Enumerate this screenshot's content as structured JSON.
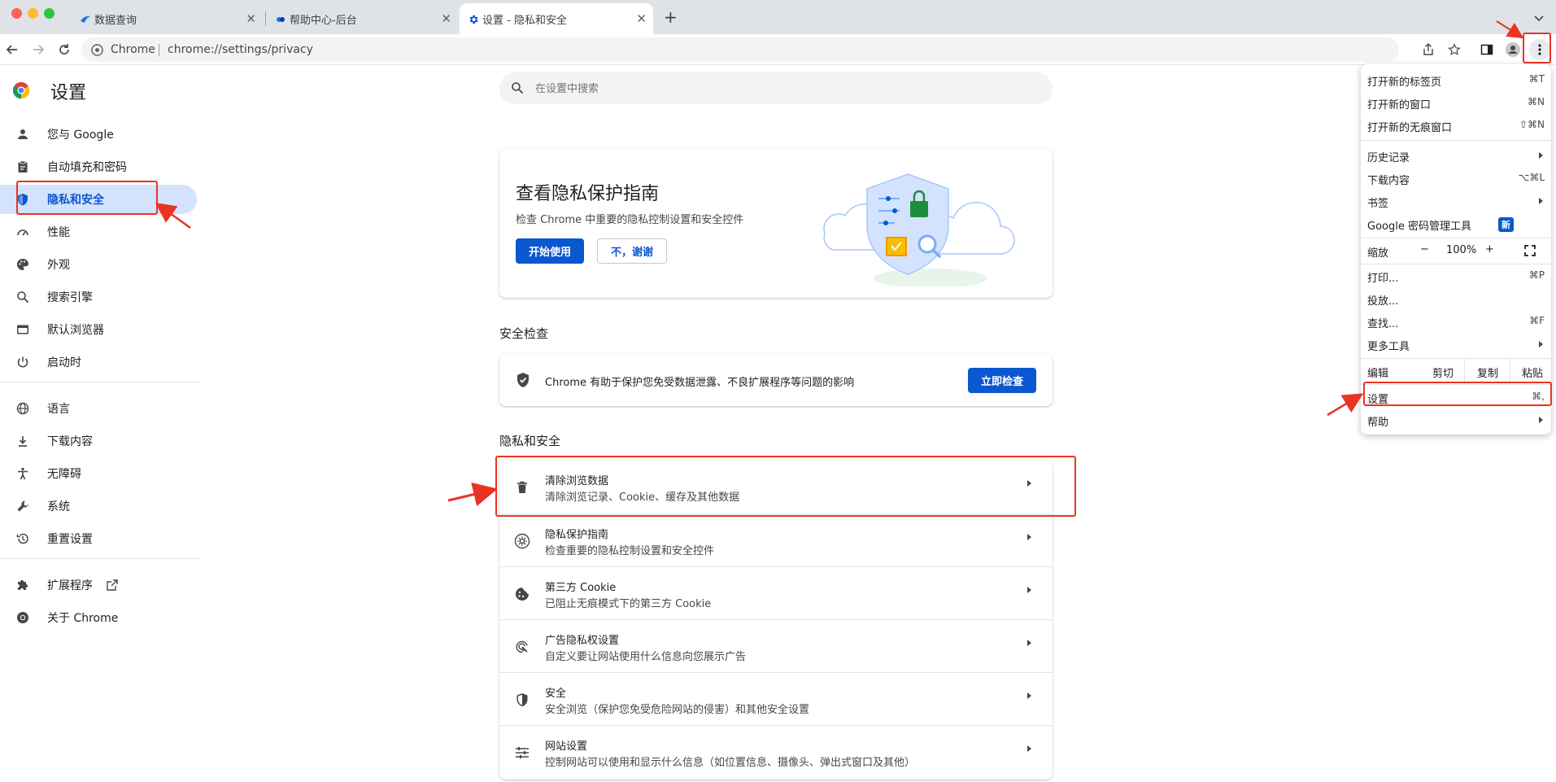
{
  "tabs": [
    {
      "title": "数据查询"
    },
    {
      "title": "帮助中心-后台"
    },
    {
      "title": "设置 - 隐私和安全"
    }
  ],
  "toolbar": {
    "site_label": "Chrome",
    "url": "chrome://settings/privacy"
  },
  "sidebar": {
    "title": "设置",
    "items": [
      {
        "label": "您与 Google"
      },
      {
        "label": "自动填充和密码"
      },
      {
        "label": "隐私和安全"
      },
      {
        "label": "性能"
      },
      {
        "label": "外观"
      },
      {
        "label": "搜索引擎"
      },
      {
        "label": "默认浏览器"
      },
      {
        "label": "启动时"
      },
      {
        "label": "语言"
      },
      {
        "label": "下载内容"
      },
      {
        "label": "无障碍"
      },
      {
        "label": "系统"
      },
      {
        "label": "重置设置"
      },
      {
        "label": "扩展程序"
      },
      {
        "label": "关于 Chrome"
      }
    ]
  },
  "search": {
    "placeholder": "在设置中搜索"
  },
  "guide": {
    "title": "查看隐私保护指南",
    "desc": "检查 Chrome 中重要的隐私控制设置和安全控件",
    "start_label": "开始使用",
    "no_label": "不，谢谢"
  },
  "safety": {
    "section_title": "安全检查",
    "desc": "Chrome 有助于保护您免受数据泄露、不良扩展程序等问题的影响",
    "button_label": "立即检查"
  },
  "privacy": {
    "section_title": "隐私和安全",
    "rows": [
      {
        "title": "清除浏览数据",
        "desc": "清除浏览记录、Cookie、缓存及其他数据"
      },
      {
        "title": "隐私保护指南",
        "desc": "检查重要的隐私控制设置和安全控件"
      },
      {
        "title": "第三方 Cookie",
        "desc": "已阻止无痕模式下的第三方 Cookie"
      },
      {
        "title": "广告隐私权设置",
        "desc": "自定义要让网站使用什么信息向您展示广告"
      },
      {
        "title": "安全",
        "desc": "安全浏览（保护您免受危险网站的侵害）和其他安全设置"
      },
      {
        "title": "网站设置",
        "desc": "控制网站可以使用和显示什么信息（如位置信息、摄像头、弹出式窗口及其他）"
      }
    ]
  },
  "menu": {
    "new_tab": {
      "label": "打开新的标签页",
      "shortcut": "⌘T"
    },
    "new_window": {
      "label": "打开新的窗口",
      "shortcut": "⌘N"
    },
    "incognito": {
      "label": "打开新的无痕窗口",
      "shortcut": "⇧⌘N"
    },
    "history": {
      "label": "历史记录"
    },
    "downloads": {
      "label": "下载内容",
      "shortcut": "⌥⌘L"
    },
    "bookmarks": {
      "label": "书签"
    },
    "password_manager": {
      "label": "Google 密码管理工具",
      "badge": "新"
    },
    "zoom": {
      "label": "缩放",
      "minus": "−",
      "value": "100%",
      "plus": "+"
    },
    "print": {
      "label": "打印...",
      "shortcut": "⌘P"
    },
    "cast": {
      "label": "投放..."
    },
    "find": {
      "label": "查找...",
      "shortcut": "⌘F"
    },
    "more_tools": {
      "label": "更多工具"
    },
    "edit": {
      "label": "编辑",
      "cut": "剪切",
      "copy": "复制",
      "paste": "粘贴"
    },
    "settings": {
      "label": "设置",
      "shortcut": "⌘,"
    },
    "help": {
      "label": "帮助"
    }
  },
  "colors": {
    "accent": "#0b57d0",
    "selected_bg": "#d3e3fd",
    "annotation": "#ea3323"
  }
}
